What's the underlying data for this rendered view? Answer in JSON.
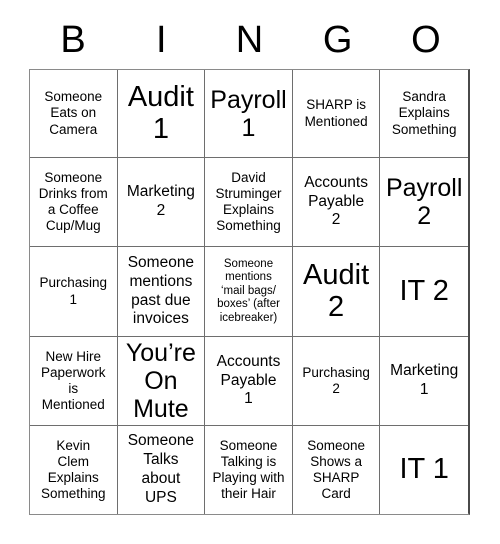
{
  "header": {
    "letters": [
      "B",
      "I",
      "N",
      "G",
      "O"
    ]
  },
  "grid": {
    "columns": 5,
    "rows": 5,
    "cells": [
      {
        "text": "Someone\nEats on\nCamera",
        "size": "sm"
      },
      {
        "text": "Audit\n1",
        "size": "xxl"
      },
      {
        "text": "Payroll\n1",
        "size": "xl"
      },
      {
        "text": "SHARP is\nMentioned",
        "size": "sm"
      },
      {
        "text": "Sandra\nExplains\nSomething",
        "size": "sm"
      },
      {
        "text": "Someone\nDrinks from\na Coffee\nCup/Mug",
        "size": "sm"
      },
      {
        "text": "Marketing\n2",
        "size": "md"
      },
      {
        "text": "David\nStruminger\nExplains\nSomething",
        "size": "sm"
      },
      {
        "text": "Accounts\nPayable\n2",
        "size": "md"
      },
      {
        "text": "Payroll\n2",
        "size": "xl"
      },
      {
        "text": "Purchasing\n1",
        "size": "sm"
      },
      {
        "text": "Someone\nmentions\npast due\ninvoices",
        "size": "md"
      },
      {
        "text": "Someone\nmentions\n‘mail bags/\nboxes’ (after\nicebreaker)",
        "size": "xs"
      },
      {
        "text": "Audit\n2",
        "size": "xxl"
      },
      {
        "text": "IT 2",
        "size": "xxl"
      },
      {
        "text": "New Hire\nPaperwork\nis\nMentioned",
        "size": "sm"
      },
      {
        "text": "You’re\nOn\nMute",
        "size": "xl"
      },
      {
        "text": "Accounts\nPayable\n1",
        "size": "md"
      },
      {
        "text": "Purchasing\n2",
        "size": "sm"
      },
      {
        "text": "Marketing\n1",
        "size": "md"
      },
      {
        "text": "Kevin\nClem\nExplains\nSomething",
        "size": "sm"
      },
      {
        "text": "Someone\nTalks\nabout\nUPS",
        "size": "md"
      },
      {
        "text": "Someone\nTalking is\nPlaying with\ntheir Hair",
        "size": "sm"
      },
      {
        "text": "Someone\nShows a\nSHARP\nCard",
        "size": "sm"
      },
      {
        "text": "IT 1",
        "size": "xxl"
      }
    ]
  }
}
